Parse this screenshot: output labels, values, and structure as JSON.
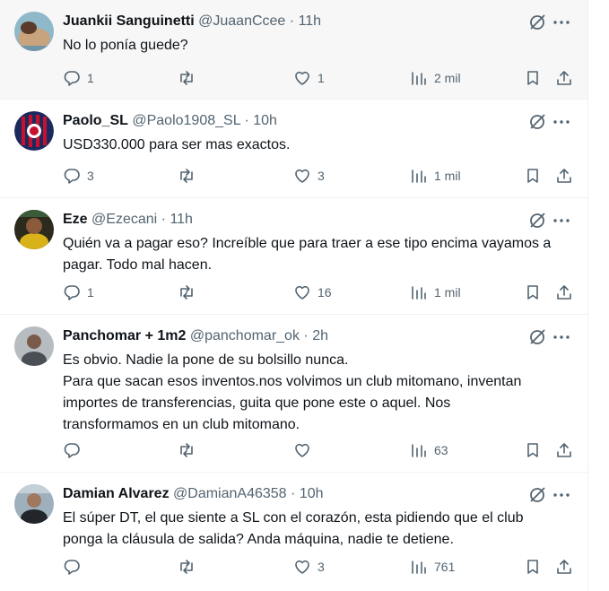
{
  "tweets": [
    {
      "name": "Juankii Sanguinetti",
      "handle": "@JuaanCcee",
      "dot": "·",
      "time": "11h",
      "lines": [
        "No lo ponía guede?"
      ],
      "replies": "1",
      "retweets": "",
      "likes": "1",
      "views": "2 mil"
    },
    {
      "name": "Paolo_SL",
      "handle": "@Paolo1908_SL",
      "dot": "·",
      "time": "10h",
      "lines": [
        "USD330.000 para ser mas exactos."
      ],
      "replies": "3",
      "retweets": "",
      "likes": "3",
      "views": "1 mil"
    },
    {
      "name": "Eze",
      "handle": "@Ezecani",
      "dot": "·",
      "time": "11h",
      "lines": [
        "Quién va a pagar eso? Increíble que para traer a ese tipo encima vayamos a",
        "pagar. Todo mal hacen."
      ],
      "replies": "1",
      "retweets": "",
      "likes": "16",
      "views": "1 mil"
    },
    {
      "name": "Panchomar + 1m2",
      "handle": "@panchomar_ok",
      "dot": "·",
      "time": "2h",
      "lines": [
        "Es obvio. Nadie la pone de su bolsillo nunca.",
        "Para que sacan esos inventos.nos volvimos un club mitomano, inventan",
        "importes de transferencias, guita que pone este o aquel. Nos",
        "transformamos en un club mitomano."
      ],
      "replies": "",
      "retweets": "",
      "likes": "",
      "views": "63"
    },
    {
      "name": "Damian Alvarez",
      "handle": "@DamianA46358",
      "dot": "·",
      "time": "10h",
      "lines": [
        "El súper DT, el que siente a SL con el corazón, esta pidiendo que el club",
        "ponga la cláusula de salida? Anda máquina, nadie te detiene."
      ],
      "replies": "",
      "retweets": "",
      "likes": "3",
      "views": "761"
    }
  ],
  "icons": {
    "reply": "reply-icon",
    "retweet": "retweet-icon",
    "like": "like-icon",
    "views": "views-icon",
    "bookmark": "bookmark-icon",
    "share": "share-icon",
    "grok": "grok-icon",
    "more": "more-icon"
  },
  "colors": {
    "text": "#0f1419",
    "secondary": "#536471",
    "border": "#eff3f4",
    "hover": "#f7f7f7"
  }
}
